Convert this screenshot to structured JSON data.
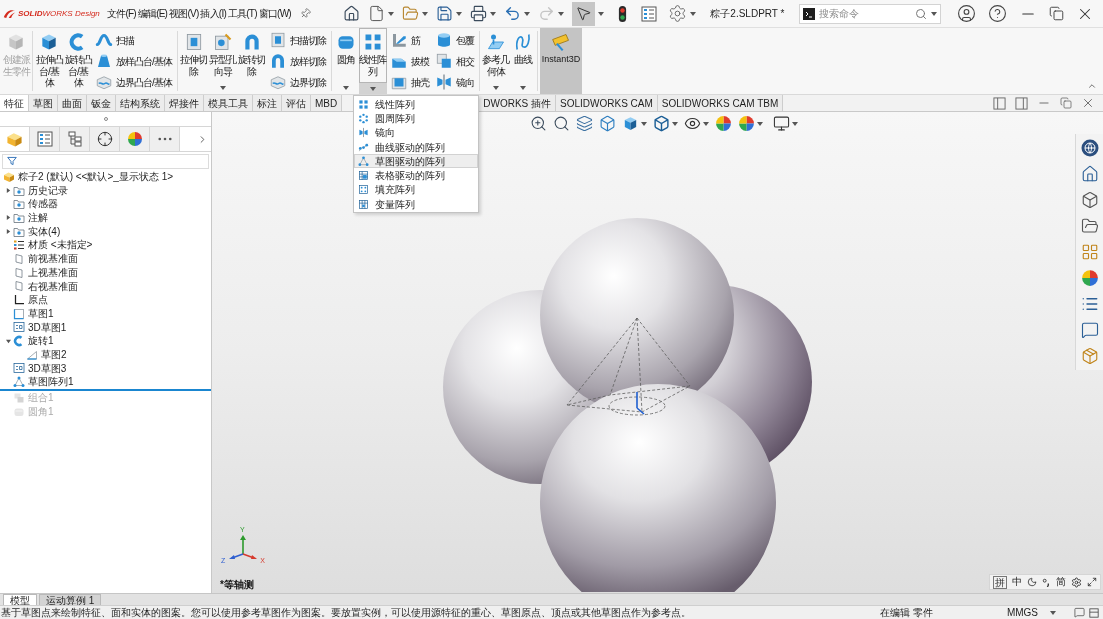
{
  "app_logo": "**SOLID**WORKS Design",
  "menu_bar": [
    "文件(F)",
    "编辑(E)",
    "视图(V)",
    "插入(I)",
    "工具(T)",
    "窗口(W)"
  ],
  "quick_access": {
    "redo_disabled": true,
    "select_active": true
  },
  "window": {
    "title": "粽子2.SLDPRT *"
  },
  "search": {
    "placeholder": "搜索命令"
  },
  "ribbon": {
    "groups": [
      {
        "columns": [
          {
            "kind": "large",
            "label": "创建派生零件",
            "disabled": true,
            "dropdown": false,
            "pressed": false
          }
        ]
      },
      {
        "columns": [
          {
            "kind": "large",
            "label": "拉伸凸台/基体",
            "disabled": false,
            "dropdown": false,
            "pressed": false
          },
          {
            "kind": "large",
            "label": "旋转凸台/基体",
            "disabled": false,
            "dropdown": false,
            "pressed": false
          },
          {
            "kind": "stack",
            "buttons": [
              "扫描",
              "放样凸台/基体",
              "边界凸台/基体"
            ]
          }
        ]
      },
      {
        "columns": [
          {
            "kind": "large",
            "label": "拉伸切除",
            "disabled": false,
            "dropdown": false,
            "pressed": false
          },
          {
            "kind": "large",
            "label": "异型孔向导",
            "disabled": false,
            "dropdown": true,
            "pressed": false
          },
          {
            "kind": "large",
            "label": "旋转切除",
            "disabled": false,
            "dropdown": false,
            "pressed": false
          },
          {
            "kind": "stack",
            "buttons": [
              "扫描切除",
              "放样切除",
              "边界切除"
            ]
          }
        ]
      },
      {
        "columns": [
          {
            "kind": "large",
            "label": "圆角",
            "disabled": false,
            "dropdown": true,
            "pressed": false
          },
          {
            "kind": "large",
            "label": "线性阵列",
            "disabled": false,
            "dropdown": true,
            "pressed": true
          },
          {
            "kind": "stack",
            "buttons": [
              "筋",
              "拔模",
              "抽壳"
            ]
          },
          {
            "kind": "stack",
            "buttons": [
              "包覆",
              "相交",
              "镜向"
            ]
          }
        ]
      },
      {
        "columns": [
          {
            "kind": "large",
            "label": "参考几何体",
            "disabled": false,
            "dropdown": true,
            "pressed": false
          },
          {
            "kind": "large",
            "label": "曲线",
            "disabled": false,
            "dropdown": true,
            "pressed": false
          }
        ]
      },
      {
        "columns": [
          {
            "kind": "large",
            "label": "Instant3D",
            "disabled": false,
            "dropdown": false,
            "pressed": true
          }
        ]
      }
    ]
  },
  "command_tabs": [
    {
      "label": "特征",
      "selected": true
    },
    {
      "label": "草图",
      "selected": false
    },
    {
      "label": "曲面",
      "selected": false
    },
    {
      "label": "钣金",
      "selected": false
    },
    {
      "label": "结构系统",
      "selected": false
    },
    {
      "label": "焊接件",
      "selected": false
    },
    {
      "label": "模具工具",
      "selected": false
    },
    {
      "label": "标注",
      "selected": false
    },
    {
      "label": "评估",
      "selected": false
    },
    {
      "label": "MBD",
      "selected": false
    },
    {
      "label": "DWORKS 插件",
      "selected": false
    },
    {
      "label": "SOLIDWORKS CAM",
      "selected": false
    },
    {
      "label": "SOLIDWORKS CAM TBM",
      "selected": false
    }
  ],
  "pattern_menu": {
    "items": [
      {
        "label": "线性阵列",
        "selected": false
      },
      {
        "label": "圆周阵列",
        "selected": false
      },
      {
        "label": "镜向",
        "selected": false
      },
      {
        "label": "曲线驱动的阵列",
        "selected": false
      },
      {
        "label": "草图驱动的阵列",
        "selected": true
      },
      {
        "label": "表格驱动的阵列",
        "selected": false
      },
      {
        "label": "填充阵列",
        "selected": false
      },
      {
        "label": "变量阵列",
        "selected": false
      }
    ]
  },
  "panel_tabs": [
    {
      "selected": true
    },
    {
      "selected": false
    },
    {
      "selected": false
    },
    {
      "selected": false
    },
    {
      "selected": false
    },
    {
      "selected": false
    }
  ],
  "feature_tree": {
    "root": {
      "label": "粽子2 (默认) <<默认>_显示状态 1>",
      "kind": "part",
      "disabled": false,
      "children": [
        {
          "label": "历史记录",
          "kind": "history",
          "disabled": false,
          "expanded": false
        },
        {
          "label": "传感器",
          "kind": "sensors",
          "disabled": false
        },
        {
          "label": "注解",
          "kind": "annotations",
          "disabled": false,
          "expanded": false
        },
        {
          "label": "实体(4)",
          "kind": "bodies",
          "disabled": false,
          "expanded": false
        },
        {
          "label": "材质 <未指定>",
          "kind": "material",
          "disabled": false
        },
        {
          "label": "前视基准面",
          "kind": "plane",
          "disabled": false
        },
        {
          "label": "上视基准面",
          "kind": "plane",
          "disabled": false
        },
        {
          "label": "右视基准面",
          "kind": "plane",
          "disabled": false
        },
        {
          "label": "原点",
          "kind": "origin",
          "disabled": false
        },
        {
          "label": "草图1",
          "kind": "sketch",
          "disabled": false
        },
        {
          "label": "3D草图1",
          "kind": "sketch3d",
          "disabled": false
        },
        {
          "label": "旋转1",
          "kind": "revolve",
          "disabled": false,
          "expanded": true,
          "children": [
            {
              "label": "草图2",
              "kind": "profile",
              "disabled": false
            }
          ]
        },
        {
          "label": "3D草图3",
          "kind": "sketch3d",
          "disabled": false
        },
        {
          "label": "草图阵列1",
          "kind": "pattern",
          "disabled": false
        },
        {
          "label": "组合1",
          "kind": "combine",
          "disabled": true
        },
        {
          "label": "圆角1",
          "kind": "fillet",
          "disabled": true
        }
      ]
    }
  },
  "viewport": {
    "view_name": "*等轴测",
    "triad_labels": [
      "Y",
      "Z",
      "X"
    ]
  },
  "ime_bar": {
    "logo": "拼",
    "language": "中",
    "charset": "简"
  },
  "document_tabs": [
    {
      "label": "模型",
      "selected": true
    },
    {
      "label": "运动算例 1",
      "selected": false
    }
  ],
  "status_bar": {
    "message": "基于草图点来绘制特征、面和实体的图案。您可以使用参考草图作为图案。要放置实例，可以使用源特征的重心、草图原点、顶点或其他草图点作为参考点。",
    "mode": "在编辑 零件",
    "units": "MMGS"
  }
}
